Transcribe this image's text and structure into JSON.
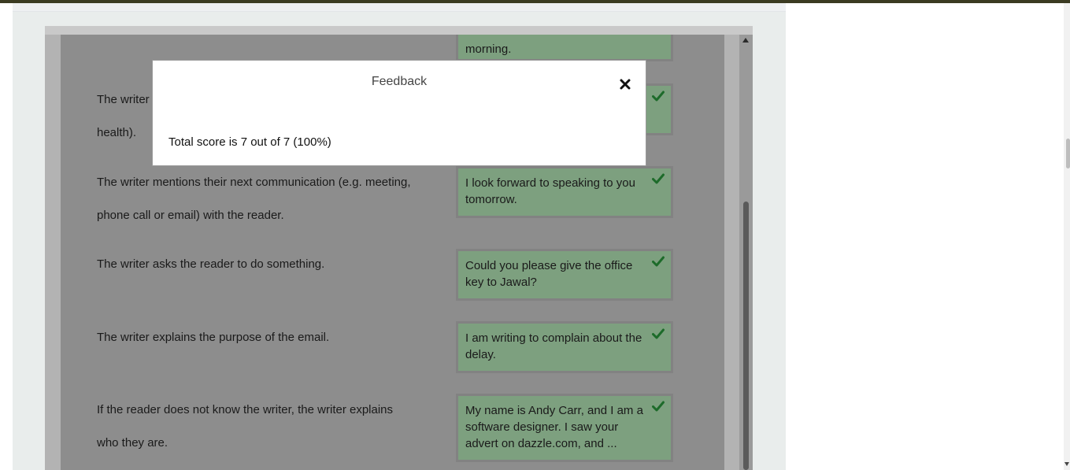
{
  "dialog": {
    "title": "Feedback",
    "close_icon": "close-icon",
    "score_text": "Total score is 7 out of 7 (100%)"
  },
  "rows": [
    {
      "prompt_lines": [],
      "answer": "morning.",
      "checked": false
    },
    {
      "prompt_lines": [
        "The writer",
        "health)."
      ],
      "answer": "",
      "checked": true
    },
    {
      "prompt_lines": [
        "The writer mentions their next communication (e.g. meeting,",
        "phone call or email) with the reader."
      ],
      "answer": "I look forward to speaking to you tomorrow.",
      "checked": true
    },
    {
      "prompt_lines": [
        "The writer asks the reader to do something."
      ],
      "answer": "Could you please give the office key to Jawal?",
      "checked": true
    },
    {
      "prompt_lines": [
        "The writer explains the purpose of the email."
      ],
      "answer": "I am writing to complain about the delay.",
      "checked": true
    },
    {
      "prompt_lines": [
        "If the reader does not know the writer, the writer explains",
        "who they are."
      ],
      "answer": "My name is Andy Carr, and I am a software designer. I saw your advert on dazzle.com, and ...",
      "checked": true
    }
  ],
  "colors": {
    "answer_bg": "#7da07f",
    "check": "#1d6b2a",
    "overlay_bg": "#8d8d8d"
  }
}
